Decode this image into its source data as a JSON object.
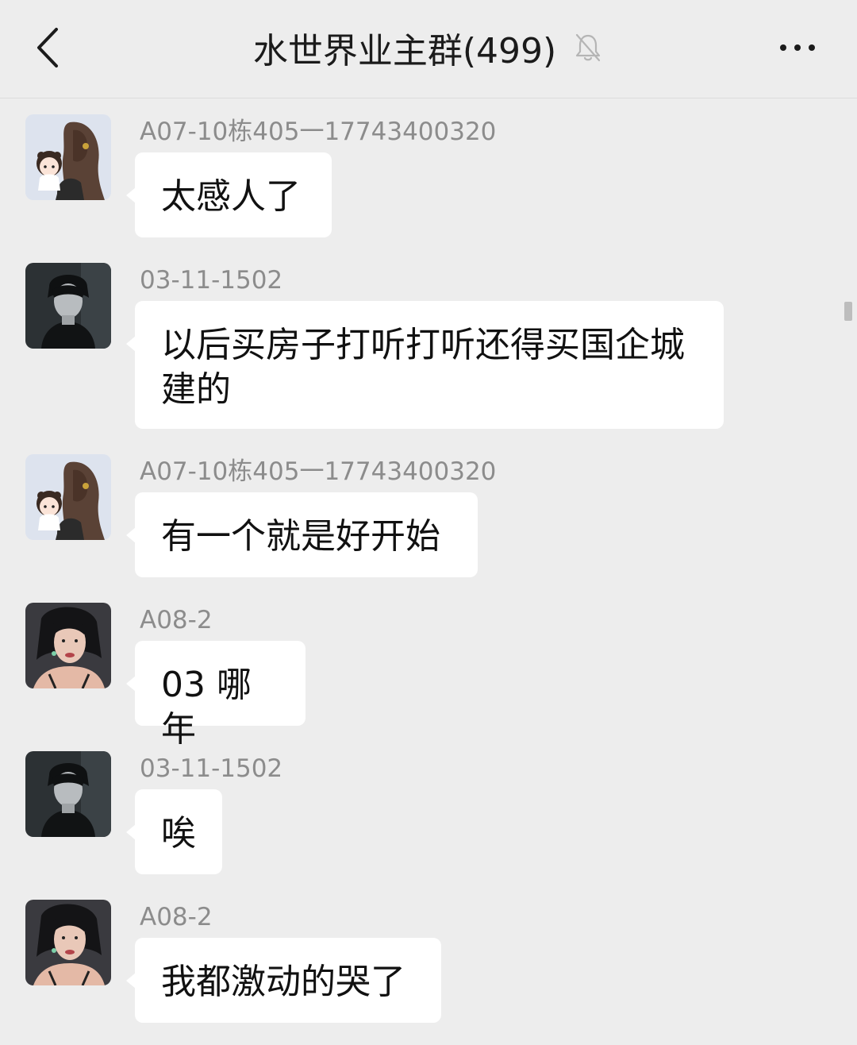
{
  "header": {
    "title": "水世界业主群(499)",
    "back_icon": "chevron-left-icon",
    "mute_icon": "bell-off-icon",
    "more_icon": "more-horizontal-icon"
  },
  "messages": [
    {
      "sender": "A07-10栋405一17743400320",
      "text": "太感人了",
      "avatar": "avatar-girl-with-child"
    },
    {
      "sender": "03-11-1502",
      "text": "以后买房子打听打听还得买国企城建的",
      "avatar": "avatar-dark-boy"
    },
    {
      "sender": "A07-10栋405一17743400320",
      "text": "有一个就是好开始",
      "avatar": "avatar-girl-with-child"
    },
    {
      "sender": "A08-2",
      "text": "03 哪年",
      "avatar": "avatar-woman-portrait"
    },
    {
      "sender": "03-11-1502",
      "text": "唉",
      "avatar": "avatar-dark-boy"
    },
    {
      "sender": "A08-2",
      "text": "我都激动的哭了",
      "avatar": "avatar-woman-portrait"
    }
  ],
  "colors": {
    "background": "#ededed",
    "bubble": "#ffffff",
    "sender_text": "#8c8c8c",
    "message_text": "#111111"
  }
}
